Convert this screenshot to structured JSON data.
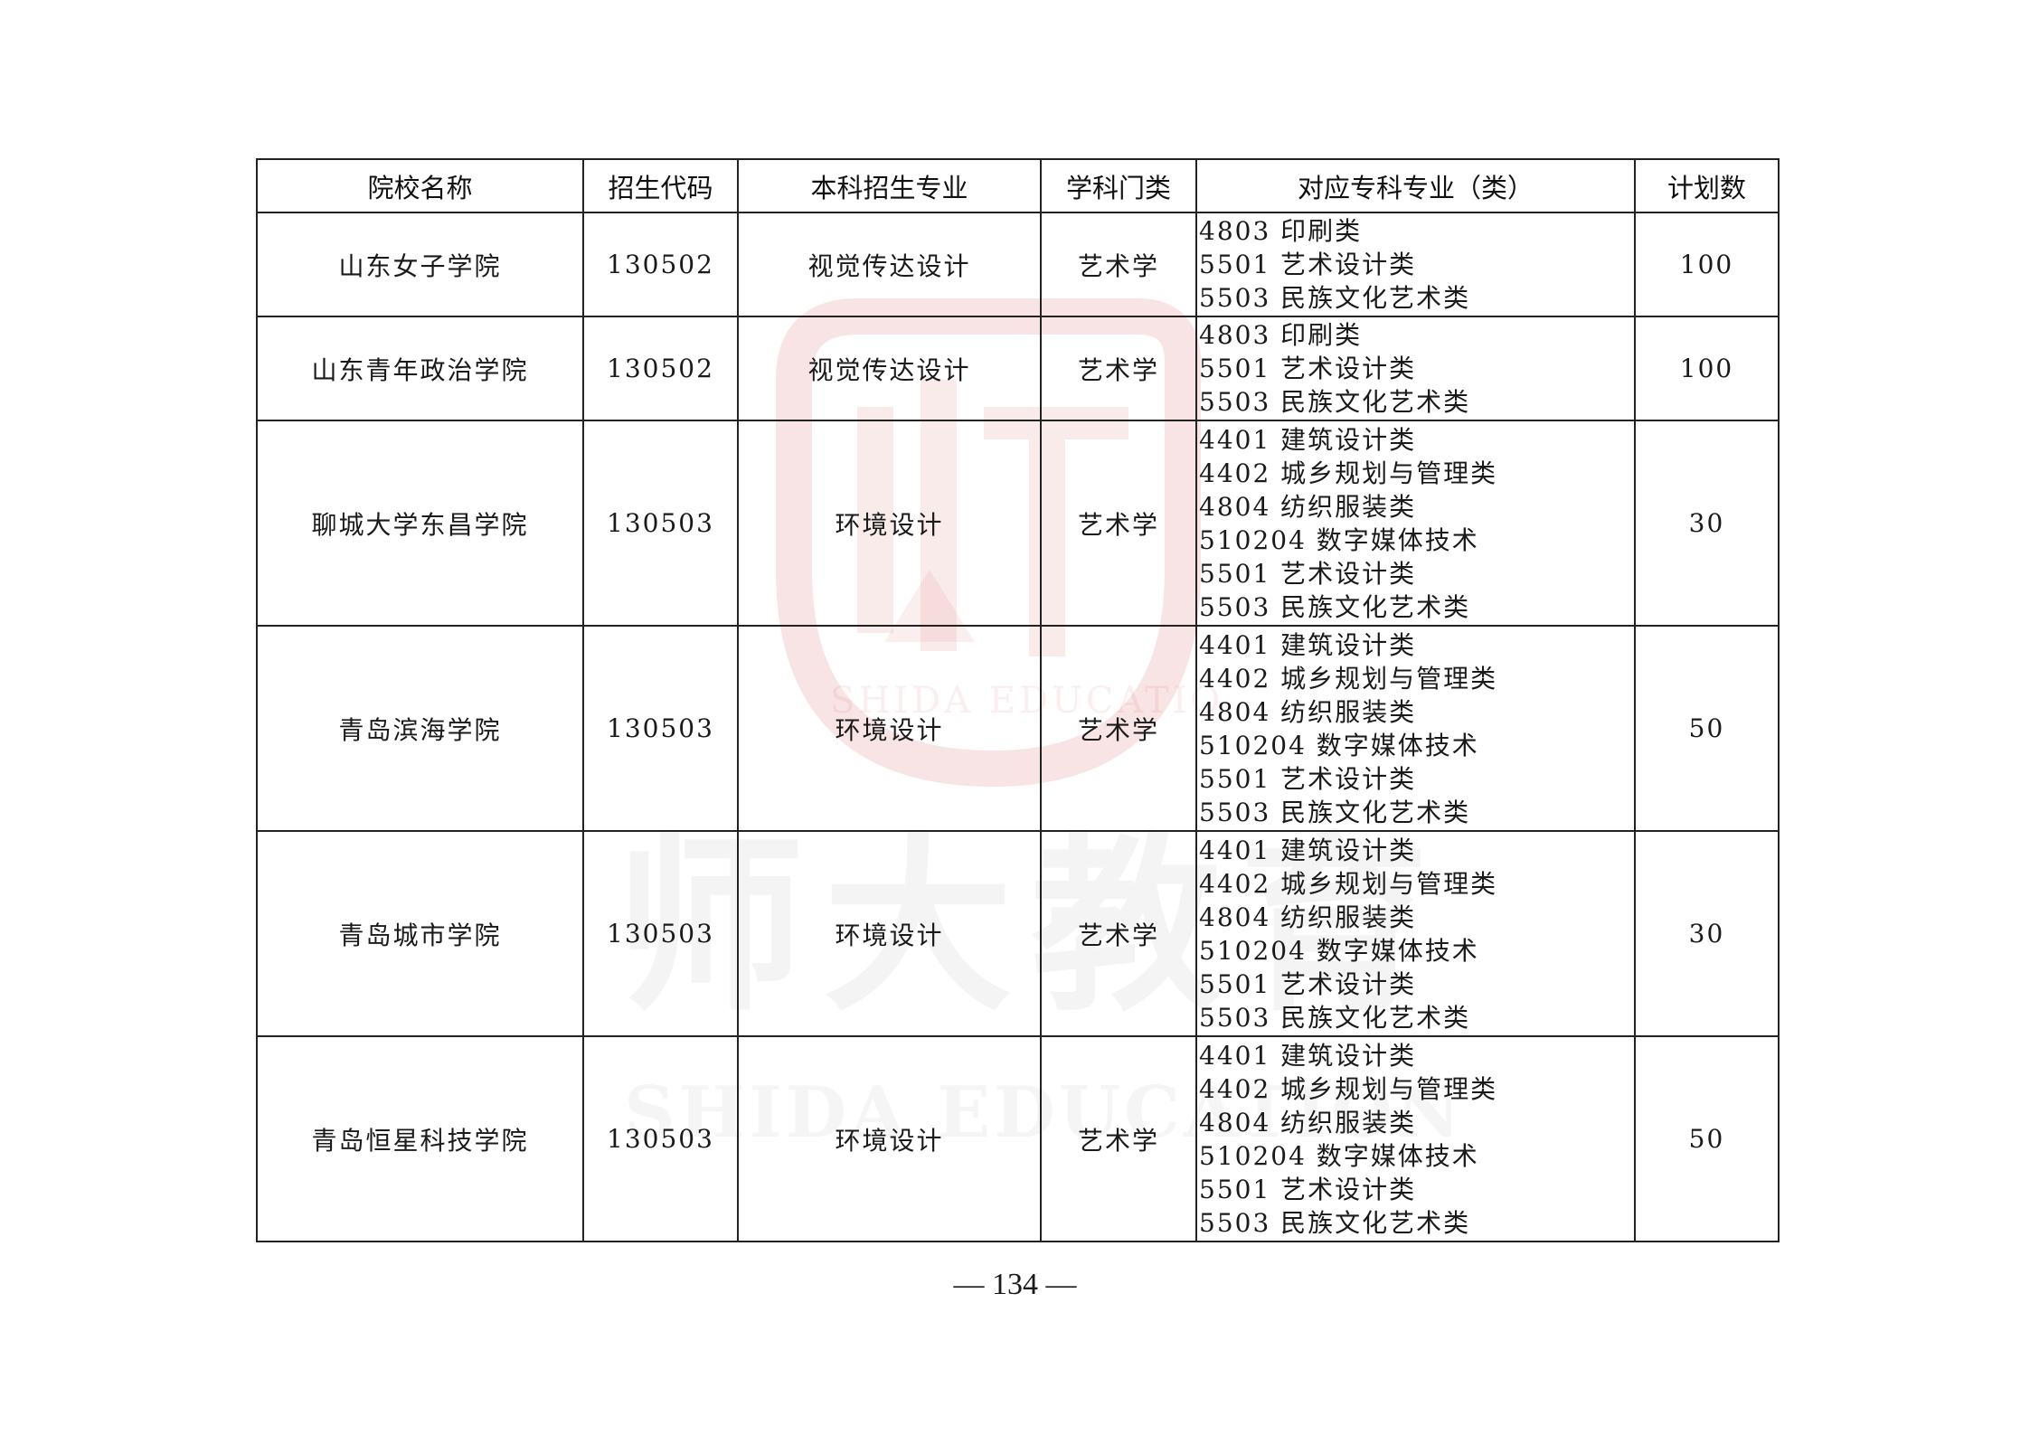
{
  "watermark": {
    "brand_cn": "师大教育",
    "brand_en_top": "SHIDA EDUCATIO",
    "brand_en_bottom": "SHIDA EDUCATION",
    "logo_color": "#d65a5a"
  },
  "table": {
    "headers": [
      "院校名称",
      "招生代码",
      "本科招生专业",
      "学科门类",
      "对应专科专业（类）",
      "计划数"
    ],
    "rows": [
      {
        "school": "山东女子学院",
        "code": "130502",
        "major": "视觉传达设计",
        "category": "艺术学",
        "specialties": [
          "4803 印刷类",
          "5501 艺术设计类",
          "5503 民族文化艺术类"
        ],
        "plan": "100"
      },
      {
        "school": "山东青年政治学院",
        "code": "130502",
        "major": "视觉传达设计",
        "category": "艺术学",
        "specialties": [
          "4803 印刷类",
          "5501 艺术设计类",
          "5503 民族文化艺术类"
        ],
        "plan": "100"
      },
      {
        "school": "聊城大学东昌学院",
        "code": "130503",
        "major": "环境设计",
        "category": "艺术学",
        "specialties": [
          "4401 建筑设计类",
          "4402 城乡规划与管理类",
          "4804 纺织服装类",
          "510204 数字媒体技术",
          "5501 艺术设计类",
          "5503 民族文化艺术类"
        ],
        "plan": "30"
      },
      {
        "school": "青岛滨海学院",
        "code": "130503",
        "major": "环境设计",
        "category": "艺术学",
        "specialties": [
          "4401 建筑设计类",
          "4402 城乡规划与管理类",
          "4804 纺织服装类",
          "510204 数字媒体技术",
          "5501 艺术设计类",
          "5503 民族文化艺术类"
        ],
        "plan": "50"
      },
      {
        "school": "青岛城市学院",
        "code": "130503",
        "major": "环境设计",
        "category": "艺术学",
        "specialties": [
          "4401 建筑设计类",
          "4402 城乡规划与管理类",
          "4804 纺织服装类",
          "510204 数字媒体技术",
          "5501 艺术设计类",
          "5503 民族文化艺术类"
        ],
        "plan": "30"
      },
      {
        "school": "青岛恒星科技学院",
        "code": "130503",
        "major": "环境设计",
        "category": "艺术学",
        "specialties": [
          "4401 建筑设计类",
          "4402 城乡规划与管理类",
          "4804 纺织服装类",
          "510204 数字媒体技术",
          "5501 艺术设计类",
          "5503 民族文化艺术类"
        ],
        "plan": "50"
      }
    ]
  },
  "page_number": "— 134 —"
}
